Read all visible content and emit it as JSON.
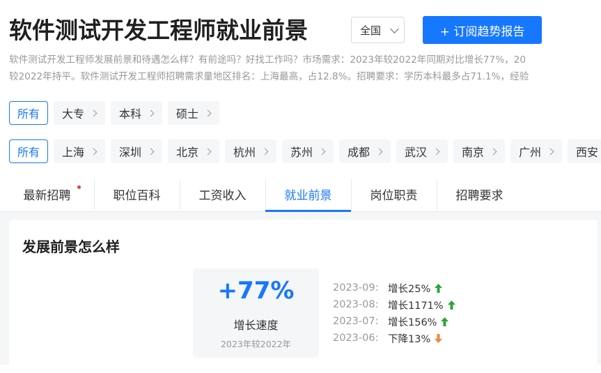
{
  "header": {
    "title": "软件测试开发工程师就业前景",
    "region": "全国",
    "subscribe_label": "+ 订阅趋势报告"
  },
  "description": {
    "line1": "软件测试开发工程师发展前景和待遇怎么样？有前途吗？好找工作吗？市场需求：2023年较2022年同期对比增长77%，20",
    "line2": "较2022年持平。软件测试开发工程师招聘需求量地区排名：上海最高，占12.8%。招聘要求：学历本科最多占71.1%，经验"
  },
  "education_filter": [
    {
      "label": "所有",
      "active": true
    },
    {
      "label": "大专",
      "active": false
    },
    {
      "label": "本科",
      "active": false
    },
    {
      "label": "硕士",
      "active": false
    }
  ],
  "city_filter": [
    {
      "label": "所有",
      "active": true
    },
    {
      "label": "上海",
      "active": false
    },
    {
      "label": "深圳",
      "active": false
    },
    {
      "label": "北京",
      "active": false
    },
    {
      "label": "杭州",
      "active": false
    },
    {
      "label": "苏州",
      "active": false
    },
    {
      "label": "成都",
      "active": false
    },
    {
      "label": "武汉",
      "active": false
    },
    {
      "label": "南京",
      "active": false
    },
    {
      "label": "广州",
      "active": false
    },
    {
      "label": "西安",
      "active": false
    }
  ],
  "tabs": [
    {
      "label": "最新招聘",
      "active": false,
      "dot": true
    },
    {
      "label": "职位百科",
      "active": false
    },
    {
      "label": "工资收入",
      "active": false
    },
    {
      "label": "就业前景",
      "active": true
    },
    {
      "label": "岗位职责",
      "active": false
    },
    {
      "label": "招聘要求",
      "active": false
    }
  ],
  "section": {
    "title": "发展前景怎么样",
    "growth_value": "+77%",
    "growth_label": "增长速度",
    "growth_note": "2023年较2022年",
    "trend": [
      {
        "date": "2023-09:",
        "value": "增长25%",
        "direction": "up"
      },
      {
        "date": "2023-08:",
        "value": "增长1171%",
        "direction": "up"
      },
      {
        "date": "2023-07:",
        "value": "增长156%",
        "direction": "up"
      },
      {
        "date": "2023-06:",
        "value": "下降13%",
        "direction": "down"
      }
    ]
  },
  "colors": {
    "accent": "#1677ff",
    "up": "#2da53b",
    "down": "#f0883e",
    "dot": "#e83b3b"
  }
}
